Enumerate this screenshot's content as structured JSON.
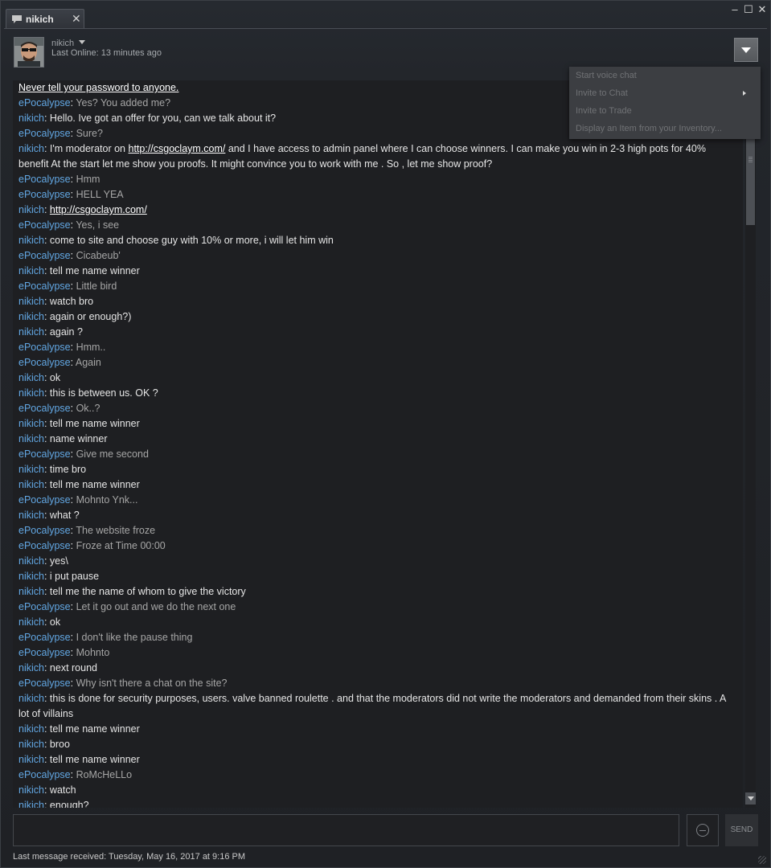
{
  "window": {
    "tab_label": "nikich",
    "tab_close": "✕",
    "minimize": "–",
    "maximize": "☐",
    "close": "✕"
  },
  "friend": {
    "name": "nikich",
    "status_label": "Last Online:",
    "status_value": "13 minutes ago"
  },
  "menu": {
    "items": [
      {
        "label": "Start voice chat",
        "has_submenu": false
      },
      {
        "label": "Invite to Chat",
        "has_submenu": true
      },
      {
        "label": "Invite to Trade",
        "has_submenu": false
      },
      {
        "label": "Display an Item from your Inventory...",
        "has_submenu": false
      }
    ]
  },
  "chat": {
    "warning": "Never tell your password to anyone.",
    "messages": [
      {
        "sender": "ePocalypse",
        "mine": false,
        "text": "Yes? You added me?"
      },
      {
        "sender": "nikich",
        "mine": true,
        "text": "Hello. Ive got an offer for you, can we talk about it?"
      },
      {
        "sender": "ePocalypse",
        "mine": false,
        "text": "Sure?"
      },
      {
        "sender": "nikich",
        "mine": true,
        "pre": "I'm moderator on ",
        "link": "http://csgoclaym.com/",
        "post": " and I have access to admin panel where I can choose winners. I can make you win in 2-3 high pots for 40% benefit At the start let me show you proofs. It might convince you to work with me . So , let me show proof?"
      },
      {
        "sender": "ePocalypse",
        "mine": false,
        "text": "Hmm"
      },
      {
        "sender": "ePocalypse",
        "mine": false,
        "text": "HELL YEA"
      },
      {
        "sender": "nikich",
        "mine": true,
        "pre": "",
        "link": "http://csgoclaym.com/",
        "post": ""
      },
      {
        "sender": "ePocalypse",
        "mine": false,
        "text": "Yes, i see"
      },
      {
        "sender": "nikich",
        "mine": true,
        "text": "come to site and choose guy with 10% or more, i will let him win"
      },
      {
        "sender": "ePocalypse",
        "mine": false,
        "text": "Cicabeub'"
      },
      {
        "sender": "nikich",
        "mine": true,
        "text": "tell me name winner"
      },
      {
        "sender": "ePocalypse",
        "mine": false,
        "text": "Little bird"
      },
      {
        "sender": "nikich",
        "mine": true,
        "text": "watch bro"
      },
      {
        "sender": "nikich",
        "mine": true,
        "text": "again or enough?)"
      },
      {
        "sender": "nikich",
        "mine": true,
        "text": "again ?"
      },
      {
        "sender": "ePocalypse",
        "mine": false,
        "text": "Hmm.."
      },
      {
        "sender": "ePocalypse",
        "mine": false,
        "text": "Again"
      },
      {
        "sender": "nikich",
        "mine": true,
        "text": "ok"
      },
      {
        "sender": "nikich",
        "mine": true,
        "text": "this is between us. OK ?"
      },
      {
        "sender": "ePocalypse",
        "mine": false,
        "text": "Ok..?"
      },
      {
        "sender": "nikich",
        "mine": true,
        "text": "tell me name winner"
      },
      {
        "sender": "nikich",
        "mine": true,
        "text": "name winner"
      },
      {
        "sender": "ePocalypse",
        "mine": false,
        "text": "Give me second"
      },
      {
        "sender": "nikich",
        "mine": true,
        "text": "time bro"
      },
      {
        "sender": "nikich",
        "mine": true,
        "text": "tell me name winner"
      },
      {
        "sender": "ePocalypse",
        "mine": false,
        "text": "Mohnto Ynk..."
      },
      {
        "sender": "nikich",
        "mine": true,
        "text": "what ?"
      },
      {
        "sender": "ePocalypse",
        "mine": false,
        "text": "The website froze"
      },
      {
        "sender": "ePocalypse",
        "mine": false,
        "text": "Froze at Time 00:00"
      },
      {
        "sender": "nikich",
        "mine": true,
        "text": "yes\\"
      },
      {
        "sender": "nikich",
        "mine": true,
        "text": "i put pause"
      },
      {
        "sender": "nikich",
        "mine": true,
        "text": "tell me the name of whom to give the victory"
      },
      {
        "sender": "ePocalypse",
        "mine": false,
        "text": "Let it go out and we do the next one"
      },
      {
        "sender": "nikich",
        "mine": true,
        "text": "ok"
      },
      {
        "sender": "ePocalypse",
        "mine": false,
        "text": "I don't like the pause thing"
      },
      {
        "sender": "ePocalypse",
        "mine": false,
        "text": "Mohnto"
      },
      {
        "sender": "nikich",
        "mine": true,
        "text": "next round"
      },
      {
        "sender": "ePocalypse",
        "mine": false,
        "text": "Why isn't there a chat on the site?"
      },
      {
        "sender": "nikich",
        "mine": true,
        "text": "this is done for security purposes, users. valve banned roulette . and that the moderators did not write the moderators and demanded from their skins . A lot of villains"
      },
      {
        "sender": "nikich",
        "mine": true,
        "text": "tell me name winner"
      },
      {
        "sender": "nikich",
        "mine": true,
        "text": "broo"
      },
      {
        "sender": "nikich",
        "mine": true,
        "text": "tell me name winner"
      },
      {
        "sender": "ePocalypse",
        "mine": false,
        "text": "RoMcHeLLo"
      },
      {
        "sender": "nikich",
        "mine": true,
        "text": "watch"
      },
      {
        "sender": "nikich",
        "mine": true,
        "text": "enough?"
      }
    ]
  },
  "compose": {
    "value": "",
    "send_label": "SEND"
  },
  "footer": {
    "last_message": "Last message received: Tuesday, May 16, 2017 at 9:16 PM"
  }
}
